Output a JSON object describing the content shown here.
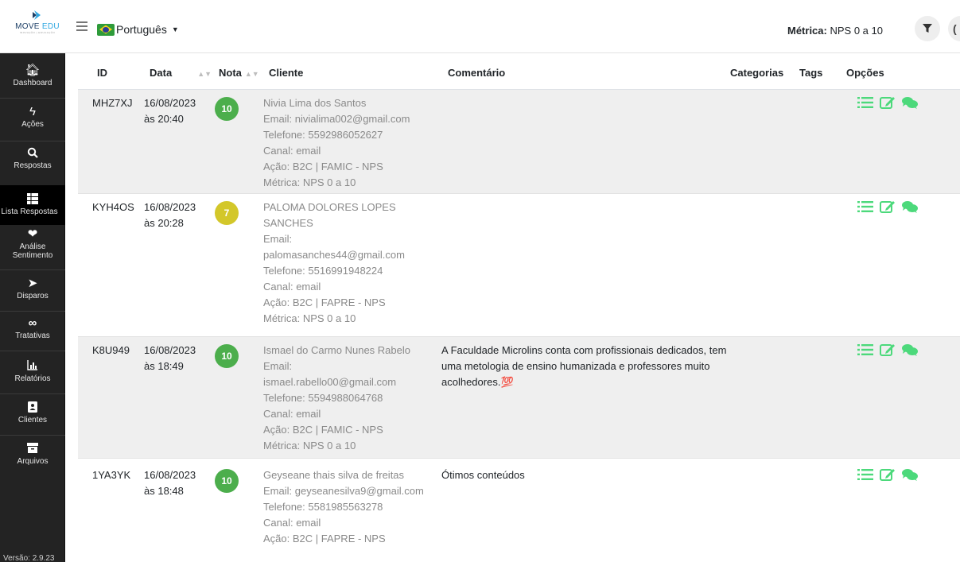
{
  "header": {
    "logo": {
      "text_main": "MOVE",
      "text_accent": "EDU",
      "tagline": "INOVAÇÃO | EDUCAÇÃO"
    },
    "language": "Português",
    "metric_label": "Métrica:",
    "metric_value": "NPS 0 a 10"
  },
  "sidebar": {
    "items": [
      {
        "label": "Dashboard",
        "icon": "home-icon"
      },
      {
        "label": "Ações",
        "icon": "bolt-icon"
      },
      {
        "label": "Respostas",
        "icon": "search-icon"
      },
      {
        "label": "Lista Respostas",
        "icon": "grid-icon",
        "active": true
      },
      {
        "label": "Análise",
        "label2": "Sentimento",
        "icon": "heart-hand-icon"
      },
      {
        "label": "Disparos",
        "icon": "paper-plane-icon"
      },
      {
        "label": "Tratativas",
        "icon": "infinity-icon"
      },
      {
        "label": "Relatórios",
        "icon": "bar-chart-icon"
      },
      {
        "label": "Clientes",
        "icon": "address-book-icon"
      },
      {
        "label": "Arquivos",
        "icon": "archive-icon"
      }
    ],
    "version": "Versão: 2.9.23"
  },
  "table": {
    "columns": {
      "id": "ID",
      "date": "Data",
      "score": "Nota",
      "client": "Cliente",
      "comment": "Comentário",
      "categories": "Categorias",
      "tags": "Tags",
      "options": "Opções"
    },
    "rows": [
      {
        "id": "MHZ7XJ",
        "date": "16/08/2023",
        "time": "às 20:40",
        "score": "10",
        "client_name": "Nivia Lima dos Santos",
        "email": "Email: nivialima002@gmail.com",
        "phone": "Telefone: 5592986052627",
        "channel": "Canal: email",
        "action": "Ação: B2C | FAMIC - NPS",
        "metric": "Métrica: NPS 0 a 10",
        "comment": ""
      },
      {
        "id": "KYH4OS",
        "date": "16/08/2023",
        "time": "às 20:28",
        "score": "7",
        "client_name": "PALOMA DOLORES LOPES SANCHES",
        "email": "Email: palomasanches44@gmail.com",
        "phone": "Telefone: 5516991948224",
        "channel": "Canal: email",
        "action": "Ação: B2C | FAPRE - NPS",
        "metric": "Métrica: NPS 0 a 10",
        "comment": ""
      },
      {
        "id": "K8U949",
        "date": "16/08/2023",
        "time": "às 18:49",
        "score": "10",
        "client_name": "Ismael do Carmo Nunes Rabelo",
        "email": "Email: ismael.rabello00@gmail.com",
        "phone": "Telefone: 5594988064768",
        "channel": "Canal: email",
        "action": "Ação: B2C | FAMIC - NPS",
        "metric": "Métrica: NPS 0 a 10",
        "comment": "A Faculdade Microlins conta com profissionais dedicados, tem uma metologia de ensino humanizada e professores muito acolhedores.💯"
      },
      {
        "id": "1YA3YK",
        "date": "16/08/2023",
        "time": "às 18:48",
        "score": "10",
        "client_name": "Geyseane thais silva de freitas",
        "email": "Email: geyseanesilva9@gmail.com",
        "phone": "Telefone: 5581985563278",
        "channel": "Canal: email",
        "action": "Ação: B2C | FAPRE - NPS",
        "metric": "",
        "comment": "Ótimos conteúdos"
      }
    ]
  },
  "colors": {
    "promoter": "#4cae4c",
    "passive": "#d3c72a",
    "option_icons": "#4cd97b",
    "sidebar_bg": "#232323"
  }
}
